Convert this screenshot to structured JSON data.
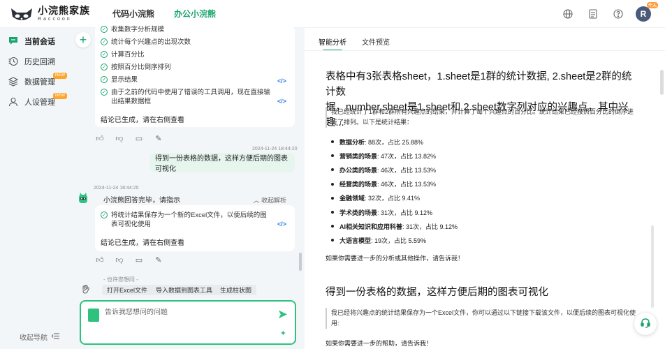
{
  "app": {
    "title": "小浣熊家族",
    "subtitle": "Raccoon"
  },
  "top_tabs": [
    {
      "label": "代码小浣熊"
    },
    {
      "label": "办公小浣熊"
    }
  ],
  "user": {
    "initial": "R",
    "badge": "个人"
  },
  "sidebar": {
    "items": [
      {
        "label": "当前会话"
      },
      {
        "label": "历史回溯"
      },
      {
        "label": "数据管理",
        "badge": "NEW"
      },
      {
        "label": "人设管理",
        "badge": "NEW"
      }
    ],
    "collapse_label": "收起导航"
  },
  "chat": {
    "card1": {
      "steps": [
        "收集数字分析规模",
        "统计每个兴趣点的出现次数",
        "计算百分比",
        "按照百分比倒序排列",
        "显示结果",
        "由于之前的代码中使用了错误的工具调用，现在直接输出结果数据框"
      ],
      "conclusion": "结论已生成，请在右侧查看"
    },
    "user_msg": {
      "timestamp": "2024-11-24 18:44:20",
      "text": "得到一份表格的数据，这样方便后期的图表可视化"
    },
    "bot_msg": {
      "timestamp": "2024-11-24 18:44:20",
      "header": "小浣熊回答完毕，请指示",
      "collapse": "收起解析",
      "steps": [
        "将统计结果保存为一个新的Excel文件，以便后续的图表可视化使用"
      ],
      "conclusion": "结论已生成，请在右侧查看"
    },
    "suggest_label": "- 也许您想问 -",
    "chips": [
      "打开Excel文件",
      "导入数据到图表工具",
      "生成柱状图"
    ],
    "input_placeholder": "告诉我您想问的问题"
  },
  "panel": {
    "tabs": [
      {
        "label": "智能分析"
      },
      {
        "label": "文件预览"
      }
    ],
    "section1": {
      "title_line1": "表格中有3张表格sheet，1.sheet是1群的统计数据, 2.sheet是2群的统计数",
      "title_line2": "据，number.sheet是1.sheet和 2.sheet数字列对应的兴趣点，其中兴趣...",
      "quote_line1": "我已经统计了1群和2群所有兴趣点的结果，并计算了每个兴趣点的百分比。统计结果已经按照百分比的倒序进",
      "quote_line2": "行了排列。以下是统计结果：",
      "items": [
        {
          "name": "数据分析",
          "detail": ": 88次，占比 25.88%"
        },
        {
          "name": "营销类的场景",
          "detail": ": 47次，占比 13.82%"
        },
        {
          "name": "办公类的场景",
          "detail": ": 46次，占比 13.53%"
        },
        {
          "name": "经营类的场景",
          "detail": ": 46次，占比 13.53%"
        },
        {
          "name": "金融领域",
          "detail": ": 32次，占比 9.41%"
        },
        {
          "name": "学术类的场景",
          "detail": ": 31次，占比 9.12%"
        },
        {
          "name": "AI相关知识和应用科普",
          "detail": ": 31次，占比 9.12%"
        },
        {
          "name": "大语言模型",
          "detail": ": 19次，占比 5.59%"
        }
      ],
      "followup": "如果你需要进一步的分析或其他操作，请告诉我！"
    },
    "section2": {
      "title": "得到一份表格的数据，这样方便后期的图表可视化",
      "quote_line1": "我已经将兴趣点的统计结果保存为一个Excel文件，你可以通过以下链接下载该文件，以便后续的图表可视化使",
      "quote_line2": "用:",
      "followup": "如果你需要进一步的帮助，请告诉我！"
    }
  },
  "colors": {
    "accent": "#1aa36d",
    "bubble": "#e6f5ee",
    "link": "#2a7ee8"
  }
}
